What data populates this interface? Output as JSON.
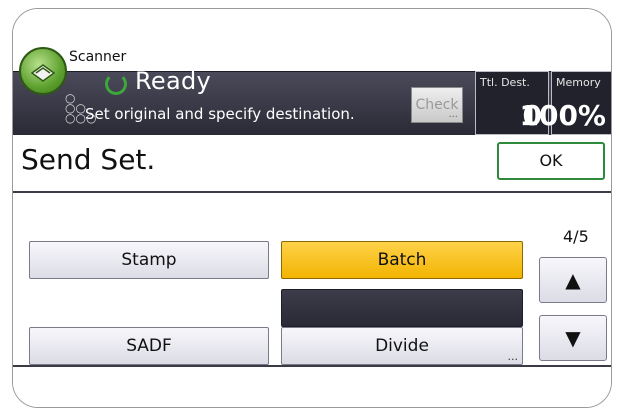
{
  "header": {
    "app_name": "Scanner",
    "status": "Ready",
    "instruction": "Set original and specify destination.",
    "check_button": "Check",
    "check_ellipsis": "...",
    "total_dest_label": "Ttl. Dest.",
    "total_dest_value": "0",
    "memory_label": "Memory",
    "memory_value": "100%",
    "status_icon": "ready-ring-icon",
    "app_icon": "scanner-icon"
  },
  "title_bar": {
    "title": "Send Set.",
    "ok_label": "OK"
  },
  "panel": {
    "stamp_label": "Stamp",
    "batch_label": "Batch",
    "sadf_label": "SADF",
    "divide_label": "Divide",
    "divide_ellipsis": "...",
    "page_indicator": "4/5",
    "up_arrow": "▲",
    "down_arrow": "▼"
  },
  "colors": {
    "selected": "#f2b400",
    "status_band": "#2a2a36",
    "ok_border": "#2e8b3c",
    "ready_icon": "#3ea63a"
  }
}
